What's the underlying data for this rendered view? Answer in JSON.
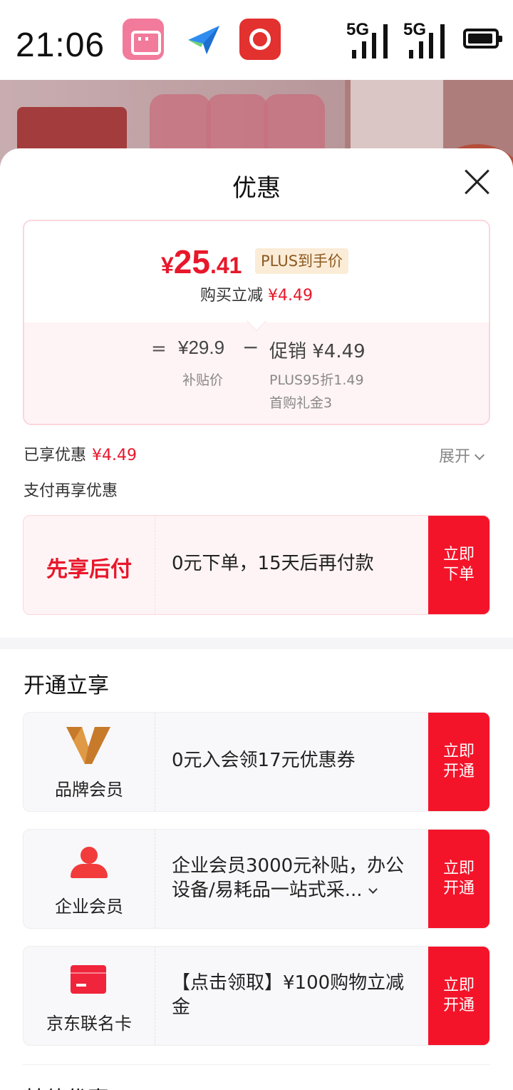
{
  "status_bar": {
    "time": "21:06",
    "network_1": "5G",
    "network_2": "5G",
    "apps": [
      "bilibili-icon",
      "send-icon",
      "netease-music-icon"
    ]
  },
  "sheet": {
    "title": "优惠",
    "price": {
      "symbol": "¥",
      "integer": "25",
      "decimal": ".41",
      "tag": "PLUS到手价",
      "instant_label": "购买立减",
      "instant_value": "¥4.49"
    },
    "breakdown": {
      "equals": "=",
      "base_price": "¥29.9",
      "base_label": "补贴价",
      "minus": "−",
      "promo": "促销 ¥4.49",
      "promo_detail_1": "PLUS95折1.49",
      "promo_detail_2": "首购礼金3"
    },
    "enjoyed": {
      "label": "已享优惠",
      "value": "¥4.49",
      "expand": "展开"
    },
    "pay_more_title": "支付再享优惠",
    "pay_later": {
      "label": "先享后付",
      "desc": "0元下单，15天后再付款",
      "button": "立即下单"
    },
    "open_section_title": "开通立享",
    "memberships": [
      {
        "label": "品牌会员",
        "desc": "0元入会领17元优惠券",
        "button": "立即开通",
        "icon": "v-brand-icon"
      },
      {
        "label": "企业会员",
        "desc": "企业会员3000元补贴，办公设备/易耗品一站式采...",
        "button": "立即开通",
        "icon": "person-icon"
      },
      {
        "label": "京东联名卡",
        "desc": "【点击领取】¥100购物立减金",
        "button": "立即开通",
        "icon": "credit-card-icon"
      }
    ],
    "other_section_title": "其他优惠"
  },
  "colors": {
    "accent": "#f4142a",
    "price_red": "#e8172b",
    "plus_tag_bg": "#fbecd7",
    "plus_tag_text": "#8c5a21"
  }
}
